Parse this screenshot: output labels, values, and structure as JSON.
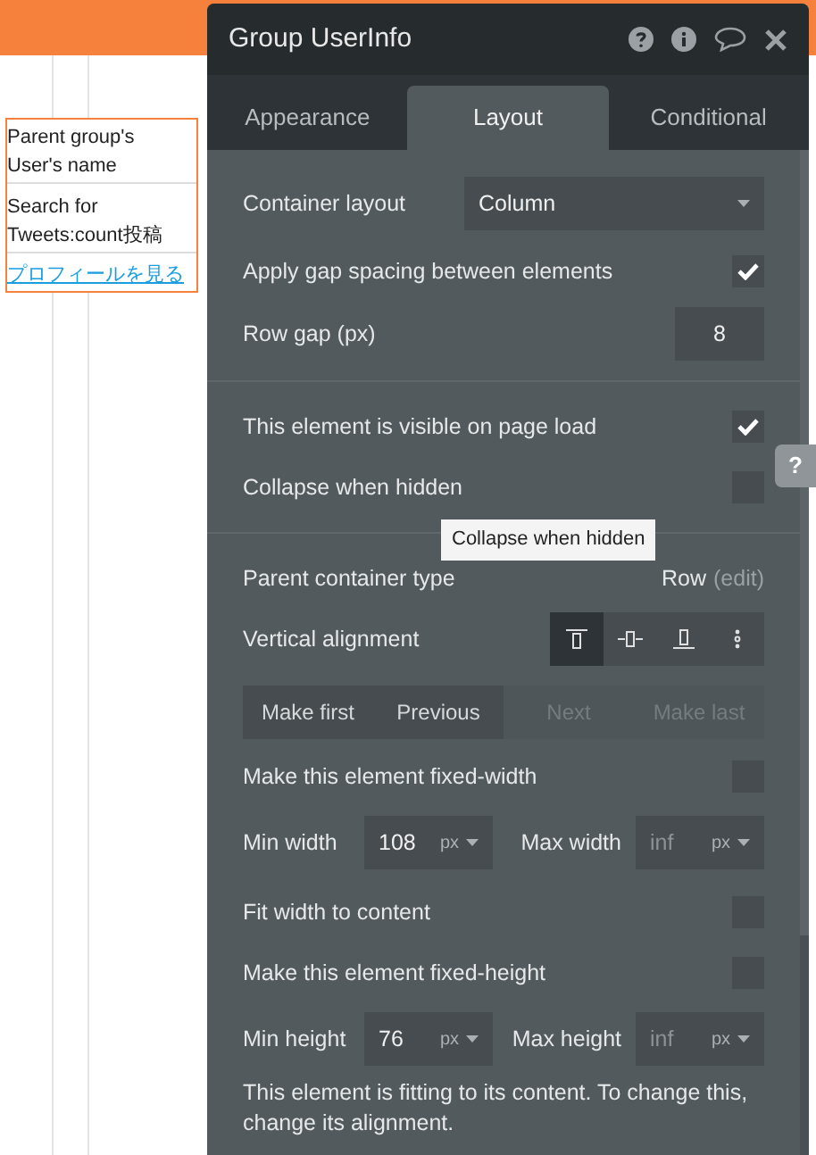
{
  "canvas": {
    "texts": [
      {
        "kind": "text",
        "text": "Parent group's User's name"
      },
      {
        "kind": "text",
        "text": "Search for Tweets:count投稿"
      },
      {
        "kind": "link",
        "text": "プロフィールを見る"
      }
    ]
  },
  "panel": {
    "title": "Group UserInfo",
    "tabs": [
      {
        "label": "Appearance",
        "selected": false
      },
      {
        "label": "Layout",
        "selected": true
      },
      {
        "label": "Conditional",
        "selected": false
      }
    ],
    "container_layout": {
      "label": "Container layout",
      "value": "Column"
    },
    "gap_spacing": {
      "label": "Apply gap spacing between elements",
      "checked": true
    },
    "row_gap": {
      "label": "Row gap (px)",
      "value": "8"
    },
    "visible_on_load": {
      "label": "This element is visible on page load",
      "checked": true
    },
    "collapse_when_hidden": {
      "label": "Collapse when hidden",
      "checked": false
    },
    "tooltip": "Collapse when hidden",
    "help_tab": "?",
    "parent_container": {
      "label": "Parent container type",
      "value": "Row",
      "action": "(edit)"
    },
    "vertical_alignment": {
      "label": "Vertical alignment",
      "options": [
        {
          "kind": "top",
          "selected": true
        },
        {
          "kind": "center",
          "selected": false
        },
        {
          "kind": "bottom",
          "selected": false
        },
        {
          "kind": "stretch",
          "selected": false
        }
      ]
    },
    "order_buttons": [
      {
        "label": "Make first",
        "disabled": false
      },
      {
        "label": "Previous",
        "disabled": false
      },
      {
        "label": "Next",
        "disabled": true
      },
      {
        "label": "Make last",
        "disabled": true
      }
    ],
    "fixed_width": {
      "label": "Make this element fixed-width",
      "checked": false
    },
    "width_limits": {
      "min_label": "Min width",
      "min_value": "108",
      "min_unit": "px",
      "max_label": "Max width",
      "max_placeholder": "inf",
      "max_unit": "px"
    },
    "fit_width": {
      "label": "Fit width to content",
      "checked": false
    },
    "fixed_height": {
      "label": "Make this element fixed-height",
      "checked": false
    },
    "height_limits": {
      "min_label": "Min height",
      "min_value": "76",
      "min_unit": "px",
      "max_label": "Max height",
      "max_placeholder": "inf",
      "max_unit": "px"
    },
    "note": "This element is fitting to its content. To change this, change its alignment."
  }
}
